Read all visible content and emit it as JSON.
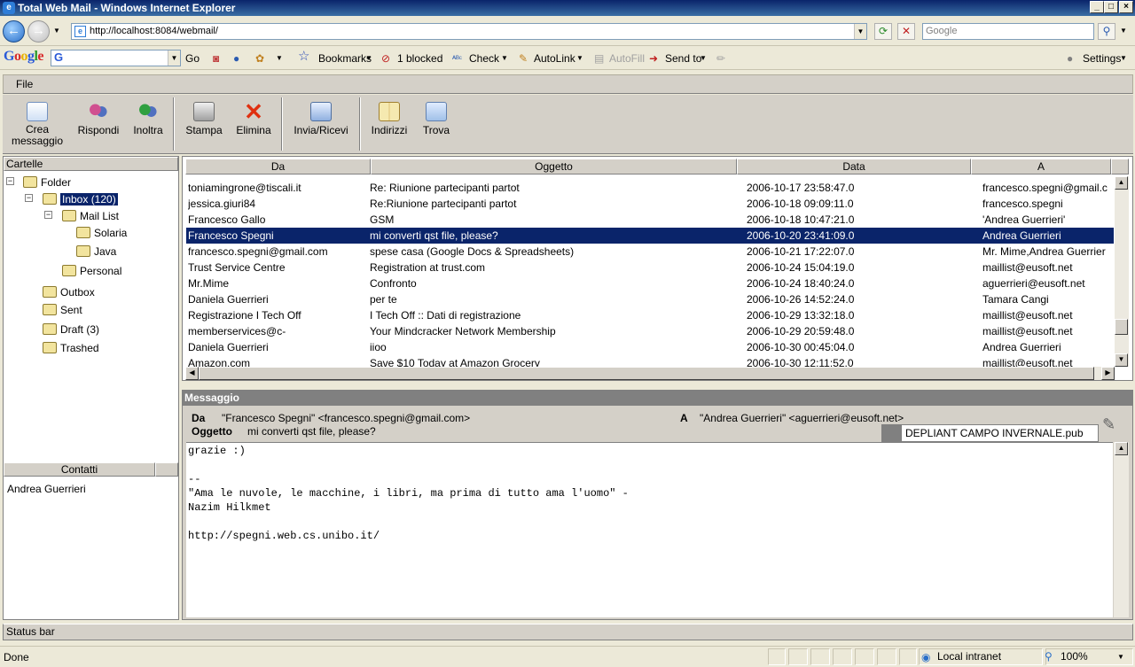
{
  "window": {
    "title": "Total Web Mail - Windows Internet Explorer"
  },
  "browser": {
    "url": "http://localhost:8084/webmail/",
    "search_placeholder": "Google"
  },
  "google_toolbar": {
    "logo": "Google",
    "search_value": "G",
    "go": "Go",
    "bookmarks": "Bookmarks",
    "blocked": "1 blocked",
    "check": "Check",
    "autolink": "AutoLink",
    "autofill": "AutoFill",
    "sendto": "Send to",
    "settings": "Settings"
  },
  "menu": {
    "file": "File"
  },
  "toolbar": {
    "crea": "Crea",
    "messaggio": "messaggio",
    "rispondi": "Rispondi",
    "inoltra": "Inoltra",
    "stampa": "Stampa",
    "elimina": "Elimina",
    "invia_ricevi": "Invia/Ricevi",
    "indirizzi": "Indirizzi",
    "trova": "Trova"
  },
  "folders": {
    "header": "Cartelle",
    "root": "Folder",
    "inbox": "Inbox (120)",
    "mail_list": "Mail List",
    "solaria": "Solaria",
    "java": "Java",
    "personal": "Personal",
    "outbox": "Outbox",
    "sent": "Sent",
    "draft": "Draft (3)",
    "trashed": "Trashed"
  },
  "contacts": {
    "header": "Contatti",
    "items": [
      "Andrea Guerrieri"
    ]
  },
  "maillist": {
    "columns": [
      "Da",
      "Oggetto",
      "Data",
      "A"
    ],
    "selected_index": 3,
    "rows": [
      [
        "toniamingrone@tiscali.it",
        "Re: Riunione partecipanti partot",
        "2006-10-17 23:58:47.0",
        "francesco.spegni@gmail.c"
      ],
      [
        "jessica.giuri84",
        "Re:Riunione partecipanti partot",
        "2006-10-18 09:09:11.0",
        "francesco.spegni"
      ],
      [
        "Francesco Gallo",
        "GSM",
        "2006-10-18 10:47:21.0",
        "'Andrea Guerrieri'"
      ],
      [
        "Francesco Spegni",
        "mi converti qst file, please?",
        "2006-10-20 23:41:09.0",
        "Andrea Guerrieri"
      ],
      [
        "francesco.spegni@gmail.com",
        "spese casa (Google Docs & Spreadsheets)",
        "2006-10-21 17:22:07.0",
        "Mr. Mime,Andrea Guerrier"
      ],
      [
        "Trust Service Centre",
        "Registration at trust.com",
        "2006-10-24 15:04:19.0",
        "maillist@eusoft.net"
      ],
      [
        "Mr.Mime",
        "Confronto",
        "2006-10-24 18:40:24.0",
        "aguerrieri@eusoft.net"
      ],
      [
        "Daniela Guerrieri",
        "per te",
        "2006-10-26 14:52:24.0",
        "Tamara Cangi"
      ],
      [
        "Registrazione I Tech Off",
        "I Tech Off :: Dati di registrazione",
        "2006-10-29 13:32:18.0",
        "maillist@eusoft.net"
      ],
      [
        "memberservices@c-",
        "Your Mindcracker Network Membership",
        "2006-10-29 20:59:48.0",
        "maillist@eusoft.net"
      ],
      [
        "Daniela Guerrieri",
        "iioo",
        "2006-10-30 00:45:04.0",
        "Andrea Guerrieri"
      ],
      [
        "Amazon.com",
        "Save $10 Today at Amazon Grocery",
        "2006-10-30 12:11:52.0",
        "maillist@eusoft.net"
      ]
    ]
  },
  "message": {
    "title": "Messaggio",
    "from_label": "Da",
    "from": "\"Francesco Spegni\" <francesco.spegni@gmail.com>",
    "to_label": "A",
    "to": "\"Andrea Guerrieri\" <aguerrieri@eusoft.net>",
    "subject_label": "Oggetto",
    "subject": "mi converti qst file, please?",
    "attachment": "DEPLIANT CAMPO INVERNALE.pub",
    "body": "grazie :)\n\n--\n\"Ama le nuvole, le macchine, i libri, ma prima di tutto ama l'uomo\" -\nNazim Hilkmet\n\nhttp://spegni.web.cs.unibo.it/"
  },
  "app_status": "Status bar",
  "ie_status": {
    "left": "Done",
    "zone": "Local intranet",
    "zoom": "100%"
  }
}
